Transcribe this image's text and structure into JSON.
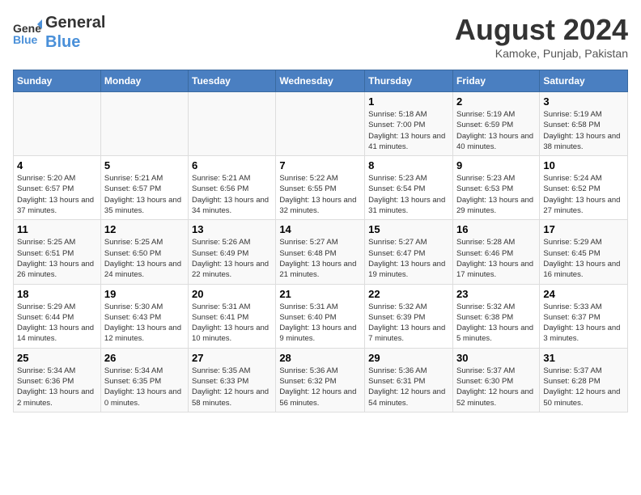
{
  "header": {
    "logo_line1": "General",
    "logo_line2": "Blue",
    "month_title": "August 2024",
    "location": "Kamoke, Punjab, Pakistan"
  },
  "weekdays": [
    "Sunday",
    "Monday",
    "Tuesday",
    "Wednesday",
    "Thursday",
    "Friday",
    "Saturday"
  ],
  "weeks": [
    [
      {
        "day": "",
        "sunrise": "",
        "sunset": "",
        "daylight": ""
      },
      {
        "day": "",
        "sunrise": "",
        "sunset": "",
        "daylight": ""
      },
      {
        "day": "",
        "sunrise": "",
        "sunset": "",
        "daylight": ""
      },
      {
        "day": "",
        "sunrise": "",
        "sunset": "",
        "daylight": ""
      },
      {
        "day": "1",
        "sunrise": "Sunrise: 5:18 AM",
        "sunset": "Sunset: 7:00 PM",
        "daylight": "Daylight: 13 hours and 41 minutes."
      },
      {
        "day": "2",
        "sunrise": "Sunrise: 5:19 AM",
        "sunset": "Sunset: 6:59 PM",
        "daylight": "Daylight: 13 hours and 40 minutes."
      },
      {
        "day": "3",
        "sunrise": "Sunrise: 5:19 AM",
        "sunset": "Sunset: 6:58 PM",
        "daylight": "Daylight: 13 hours and 38 minutes."
      }
    ],
    [
      {
        "day": "4",
        "sunrise": "Sunrise: 5:20 AM",
        "sunset": "Sunset: 6:57 PM",
        "daylight": "Daylight: 13 hours and 37 minutes."
      },
      {
        "day": "5",
        "sunrise": "Sunrise: 5:21 AM",
        "sunset": "Sunset: 6:57 PM",
        "daylight": "Daylight: 13 hours and 35 minutes."
      },
      {
        "day": "6",
        "sunrise": "Sunrise: 5:21 AM",
        "sunset": "Sunset: 6:56 PM",
        "daylight": "Daylight: 13 hours and 34 minutes."
      },
      {
        "day": "7",
        "sunrise": "Sunrise: 5:22 AM",
        "sunset": "Sunset: 6:55 PM",
        "daylight": "Daylight: 13 hours and 32 minutes."
      },
      {
        "day": "8",
        "sunrise": "Sunrise: 5:23 AM",
        "sunset": "Sunset: 6:54 PM",
        "daylight": "Daylight: 13 hours and 31 minutes."
      },
      {
        "day": "9",
        "sunrise": "Sunrise: 5:23 AM",
        "sunset": "Sunset: 6:53 PM",
        "daylight": "Daylight: 13 hours and 29 minutes."
      },
      {
        "day": "10",
        "sunrise": "Sunrise: 5:24 AM",
        "sunset": "Sunset: 6:52 PM",
        "daylight": "Daylight: 13 hours and 27 minutes."
      }
    ],
    [
      {
        "day": "11",
        "sunrise": "Sunrise: 5:25 AM",
        "sunset": "Sunset: 6:51 PM",
        "daylight": "Daylight: 13 hours and 26 minutes."
      },
      {
        "day": "12",
        "sunrise": "Sunrise: 5:25 AM",
        "sunset": "Sunset: 6:50 PM",
        "daylight": "Daylight: 13 hours and 24 minutes."
      },
      {
        "day": "13",
        "sunrise": "Sunrise: 5:26 AM",
        "sunset": "Sunset: 6:49 PM",
        "daylight": "Daylight: 13 hours and 22 minutes."
      },
      {
        "day": "14",
        "sunrise": "Sunrise: 5:27 AM",
        "sunset": "Sunset: 6:48 PM",
        "daylight": "Daylight: 13 hours and 21 minutes."
      },
      {
        "day": "15",
        "sunrise": "Sunrise: 5:27 AM",
        "sunset": "Sunset: 6:47 PM",
        "daylight": "Daylight: 13 hours and 19 minutes."
      },
      {
        "day": "16",
        "sunrise": "Sunrise: 5:28 AM",
        "sunset": "Sunset: 6:46 PM",
        "daylight": "Daylight: 13 hours and 17 minutes."
      },
      {
        "day": "17",
        "sunrise": "Sunrise: 5:29 AM",
        "sunset": "Sunset: 6:45 PM",
        "daylight": "Daylight: 13 hours and 16 minutes."
      }
    ],
    [
      {
        "day": "18",
        "sunrise": "Sunrise: 5:29 AM",
        "sunset": "Sunset: 6:44 PM",
        "daylight": "Daylight: 13 hours and 14 minutes."
      },
      {
        "day": "19",
        "sunrise": "Sunrise: 5:30 AM",
        "sunset": "Sunset: 6:43 PM",
        "daylight": "Daylight: 13 hours and 12 minutes."
      },
      {
        "day": "20",
        "sunrise": "Sunrise: 5:31 AM",
        "sunset": "Sunset: 6:41 PM",
        "daylight": "Daylight: 13 hours and 10 minutes."
      },
      {
        "day": "21",
        "sunrise": "Sunrise: 5:31 AM",
        "sunset": "Sunset: 6:40 PM",
        "daylight": "Daylight: 13 hours and 9 minutes."
      },
      {
        "day": "22",
        "sunrise": "Sunrise: 5:32 AM",
        "sunset": "Sunset: 6:39 PM",
        "daylight": "Daylight: 13 hours and 7 minutes."
      },
      {
        "day": "23",
        "sunrise": "Sunrise: 5:32 AM",
        "sunset": "Sunset: 6:38 PM",
        "daylight": "Daylight: 13 hours and 5 minutes."
      },
      {
        "day": "24",
        "sunrise": "Sunrise: 5:33 AM",
        "sunset": "Sunset: 6:37 PM",
        "daylight": "Daylight: 13 hours and 3 minutes."
      }
    ],
    [
      {
        "day": "25",
        "sunrise": "Sunrise: 5:34 AM",
        "sunset": "Sunset: 6:36 PM",
        "daylight": "Daylight: 13 hours and 2 minutes."
      },
      {
        "day": "26",
        "sunrise": "Sunrise: 5:34 AM",
        "sunset": "Sunset: 6:35 PM",
        "daylight": "Daylight: 13 hours and 0 minutes."
      },
      {
        "day": "27",
        "sunrise": "Sunrise: 5:35 AM",
        "sunset": "Sunset: 6:33 PM",
        "daylight": "Daylight: 12 hours and 58 minutes."
      },
      {
        "day": "28",
        "sunrise": "Sunrise: 5:36 AM",
        "sunset": "Sunset: 6:32 PM",
        "daylight": "Daylight: 12 hours and 56 minutes."
      },
      {
        "day": "29",
        "sunrise": "Sunrise: 5:36 AM",
        "sunset": "Sunset: 6:31 PM",
        "daylight": "Daylight: 12 hours and 54 minutes."
      },
      {
        "day": "30",
        "sunrise": "Sunrise: 5:37 AM",
        "sunset": "Sunset: 6:30 PM",
        "daylight": "Daylight: 12 hours and 52 minutes."
      },
      {
        "day": "31",
        "sunrise": "Sunrise: 5:37 AM",
        "sunset": "Sunset: 6:28 PM",
        "daylight": "Daylight: 12 hours and 50 minutes."
      }
    ]
  ]
}
